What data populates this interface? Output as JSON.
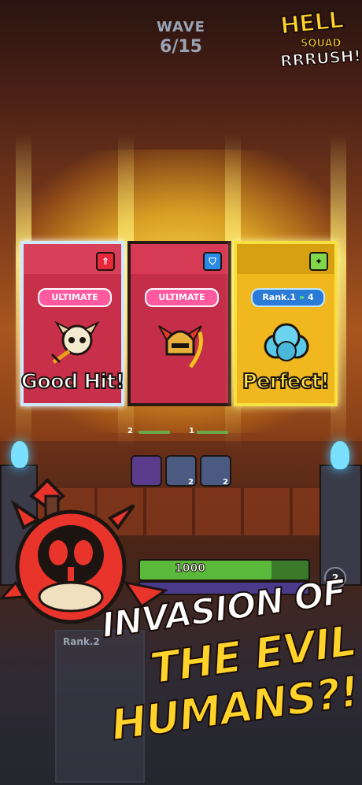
{
  "hud": {
    "wave_label": "WAVE",
    "wave_value": "6/15"
  },
  "logo": {
    "line1": "HELL",
    "line2": "SQUAD",
    "line3": "RRRUSH!"
  },
  "cards": [
    {
      "badge": "ULTIMATE",
      "result": "Good Hit!",
      "type_icon": "attack-icon",
      "icon_glyph": "⇑"
    },
    {
      "badge": "ULTIMATE",
      "result": "",
      "type_icon": "shield-icon",
      "icon_glyph": "⛉"
    },
    {
      "badge_prefix": "Rank.1",
      "badge_arrow": "»",
      "badge_suffix": "4",
      "result": "Perfect!",
      "type_icon": "sparkle-icon",
      "icon_glyph": "✦"
    }
  ],
  "battle": {
    "mini_left": "2",
    "mini_right": "1",
    "skills": [
      {
        "count": ""
      },
      {
        "count": "2"
      },
      {
        "count": "2"
      }
    ],
    "hp_value": "1000",
    "unit_count": "2",
    "slot_rank": "Rank.2"
  },
  "headline": {
    "line1": "INVASION OF",
    "line2": "THE EVIL",
    "line3": "HUMANS?!"
  },
  "colors": {
    "accent_yellow": "#ffd32a",
    "card_red": "#c8304a",
    "card_gold": "#f0b81e"
  }
}
